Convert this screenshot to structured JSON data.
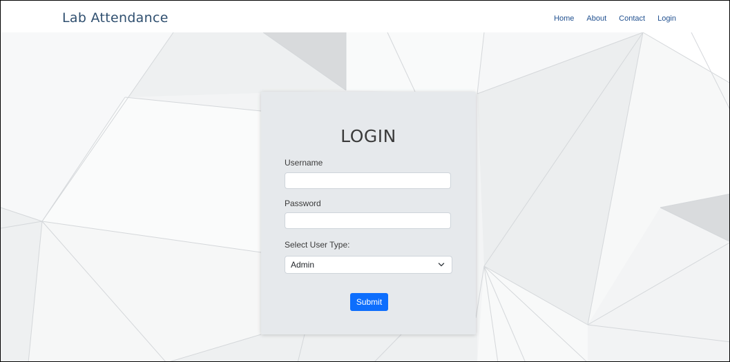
{
  "navbar": {
    "brand": "Lab Attendance",
    "links": [
      "Home",
      "About",
      "Contact",
      "Login"
    ]
  },
  "login": {
    "title": "LOGIN",
    "username_label": "Username",
    "username_value": "",
    "password_label": "Password",
    "password_value": "",
    "user_type_label": "Select User Type:",
    "user_type_value": "Admin",
    "submit_label": "Submit"
  },
  "colors": {
    "brand_text": "#2f4f6f",
    "nav_link": "#1f4f8f",
    "card_bg": "#e6e9ec",
    "submit_bg": "#0d6efd",
    "page_bg": "#f4f5f6"
  },
  "icons": {
    "select_caret": "chevron-down-icon"
  }
}
